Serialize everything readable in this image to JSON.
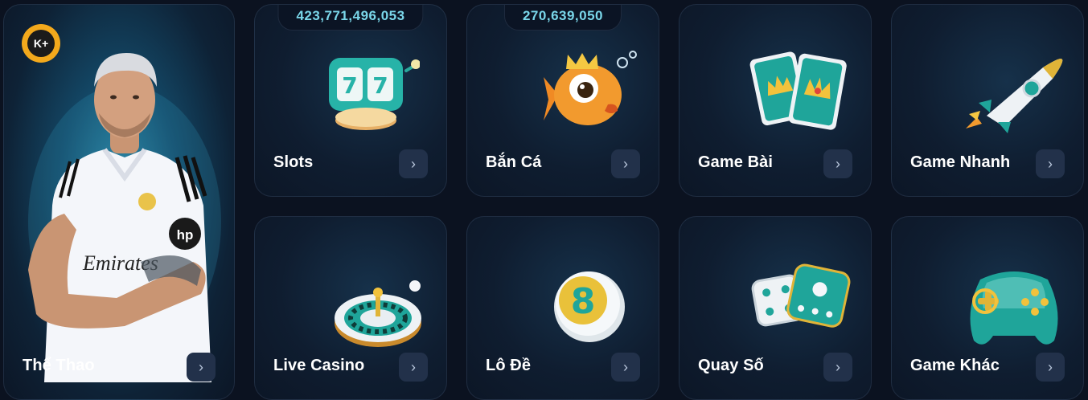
{
  "brand": {
    "badge_text": "K+",
    "badge_color": "#f3a91c"
  },
  "cards": {
    "sports": {
      "label": "Thể Thao",
      "sponsor_text": "Emirates",
      "sponsor_logo_text": "hp"
    },
    "slots": {
      "label": "Slots",
      "jackpot": "423,771,496,053",
      "icon": "slot-machine-icon",
      "reel_1": "7",
      "reel_2": "7"
    },
    "fishing": {
      "label": "Bắn Cá",
      "jackpot": "270,639,050",
      "icon": "fish-icon"
    },
    "cards_game": {
      "label": "Game Bài",
      "icon": "playing-cards-icon"
    },
    "fast_game": {
      "label": "Game Nhanh",
      "icon": "rocket-icon"
    },
    "live_casino": {
      "label": "Live Casino",
      "icon": "roulette-icon"
    },
    "lottery": {
      "label": "Lô Đề",
      "icon": "lottery-ball-icon",
      "ball_number": "8"
    },
    "draw": {
      "label": "Quay Số",
      "icon": "dice-icon"
    },
    "other": {
      "label": "Game Khác",
      "icon": "gamepad-icon"
    }
  },
  "arrow_glyph": "›",
  "colors": {
    "accent_teal": "#27b3a8",
    "jackpot_text": "#7ad7ea",
    "button_bg": "#22314a",
    "page_bg": "#0b1220"
  }
}
